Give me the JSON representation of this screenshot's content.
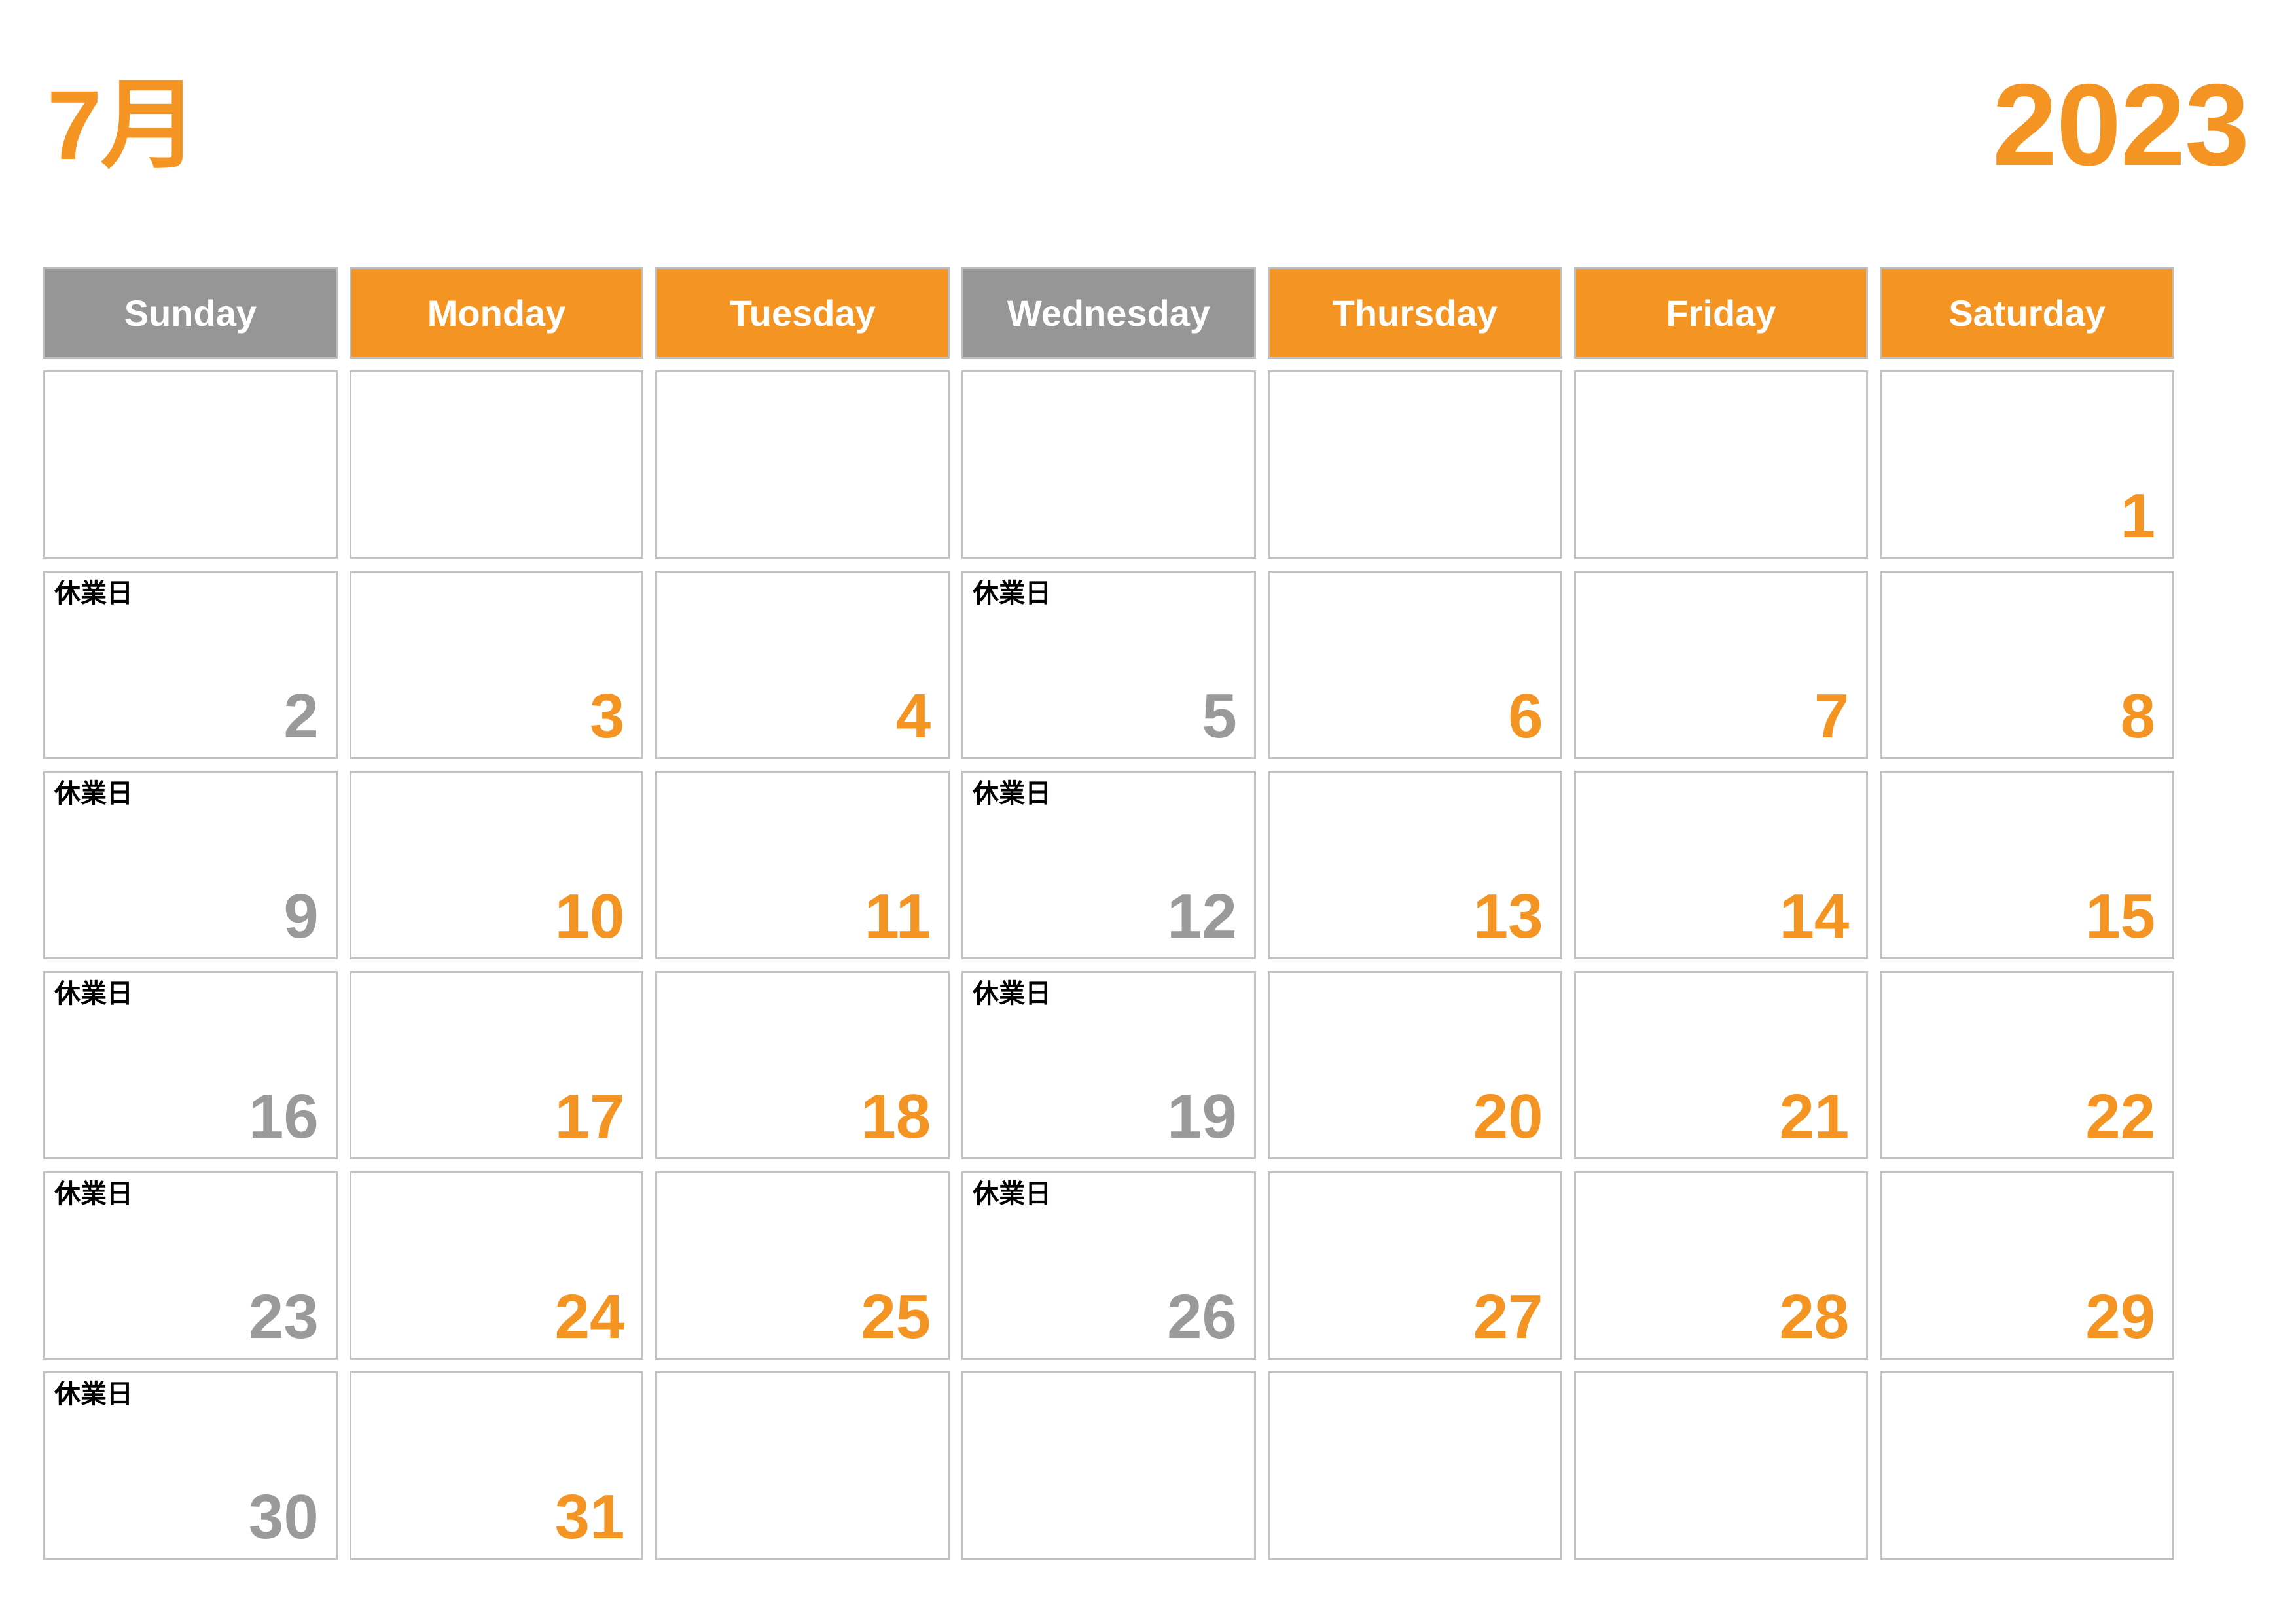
{
  "header": {
    "month_label": "7月",
    "year_label": "2023"
  },
  "colors": {
    "accent_orange": "#F39423",
    "muted_gray": "#969696",
    "number_gray": "#9A9A9A",
    "cell_border": "#C2C2C2",
    "note_black": "#000000",
    "background": "#FFFFFF"
  },
  "weekdays": [
    {
      "label": "Sunday",
      "style": "gray"
    },
    {
      "label": "Monday",
      "style": "orange"
    },
    {
      "label": "Tuesday",
      "style": "orange"
    },
    {
      "label": "Wednesday",
      "style": "gray"
    },
    {
      "label": "Thursday",
      "style": "orange"
    },
    {
      "label": "Friday",
      "style": "orange"
    },
    {
      "label": "Saturday",
      "style": "orange"
    }
  ],
  "note_text": "休業日",
  "weeks": [
    [
      {
        "day": "",
        "note": "",
        "style": "empty"
      },
      {
        "day": "",
        "note": "",
        "style": "empty"
      },
      {
        "day": "",
        "note": "",
        "style": "empty"
      },
      {
        "day": "",
        "note": "",
        "style": "empty"
      },
      {
        "day": "",
        "note": "",
        "style": "empty"
      },
      {
        "day": "",
        "note": "",
        "style": "empty"
      },
      {
        "day": "1",
        "note": "",
        "style": "orange"
      }
    ],
    [
      {
        "day": "2",
        "note": "休業日",
        "style": "gray"
      },
      {
        "day": "3",
        "note": "",
        "style": "orange"
      },
      {
        "day": "4",
        "note": "",
        "style": "orange"
      },
      {
        "day": "5",
        "note": "休業日",
        "style": "gray"
      },
      {
        "day": "6",
        "note": "",
        "style": "orange"
      },
      {
        "day": "7",
        "note": "",
        "style": "orange"
      },
      {
        "day": "8",
        "note": "",
        "style": "orange"
      }
    ],
    [
      {
        "day": "9",
        "note": "休業日",
        "style": "gray"
      },
      {
        "day": "10",
        "note": "",
        "style": "orange"
      },
      {
        "day": "11",
        "note": "",
        "style": "orange"
      },
      {
        "day": "12",
        "note": "休業日",
        "style": "gray"
      },
      {
        "day": "13",
        "note": "",
        "style": "orange"
      },
      {
        "day": "14",
        "note": "",
        "style": "orange"
      },
      {
        "day": "15",
        "note": "",
        "style": "orange"
      }
    ],
    [
      {
        "day": "16",
        "note": "休業日",
        "style": "gray"
      },
      {
        "day": "17",
        "note": "",
        "style": "orange"
      },
      {
        "day": "18",
        "note": "",
        "style": "orange"
      },
      {
        "day": "19",
        "note": "休業日",
        "style": "gray"
      },
      {
        "day": "20",
        "note": "",
        "style": "orange"
      },
      {
        "day": "21",
        "note": "",
        "style": "orange"
      },
      {
        "day": "22",
        "note": "",
        "style": "orange"
      }
    ],
    [
      {
        "day": "23",
        "note": "休業日",
        "style": "gray"
      },
      {
        "day": "24",
        "note": "",
        "style": "orange"
      },
      {
        "day": "25",
        "note": "",
        "style": "orange"
      },
      {
        "day": "26",
        "note": "休業日",
        "style": "gray"
      },
      {
        "day": "27",
        "note": "",
        "style": "orange"
      },
      {
        "day": "28",
        "note": "",
        "style": "orange"
      },
      {
        "day": "29",
        "note": "",
        "style": "orange"
      }
    ],
    [
      {
        "day": "30",
        "note": "休業日",
        "style": "gray"
      },
      {
        "day": "31",
        "note": "",
        "style": "orange"
      },
      {
        "day": "",
        "note": "",
        "style": "empty"
      },
      {
        "day": "",
        "note": "",
        "style": "empty"
      },
      {
        "day": "",
        "note": "",
        "style": "empty"
      },
      {
        "day": "",
        "note": "",
        "style": "empty"
      },
      {
        "day": "",
        "note": "",
        "style": "empty"
      }
    ]
  ]
}
